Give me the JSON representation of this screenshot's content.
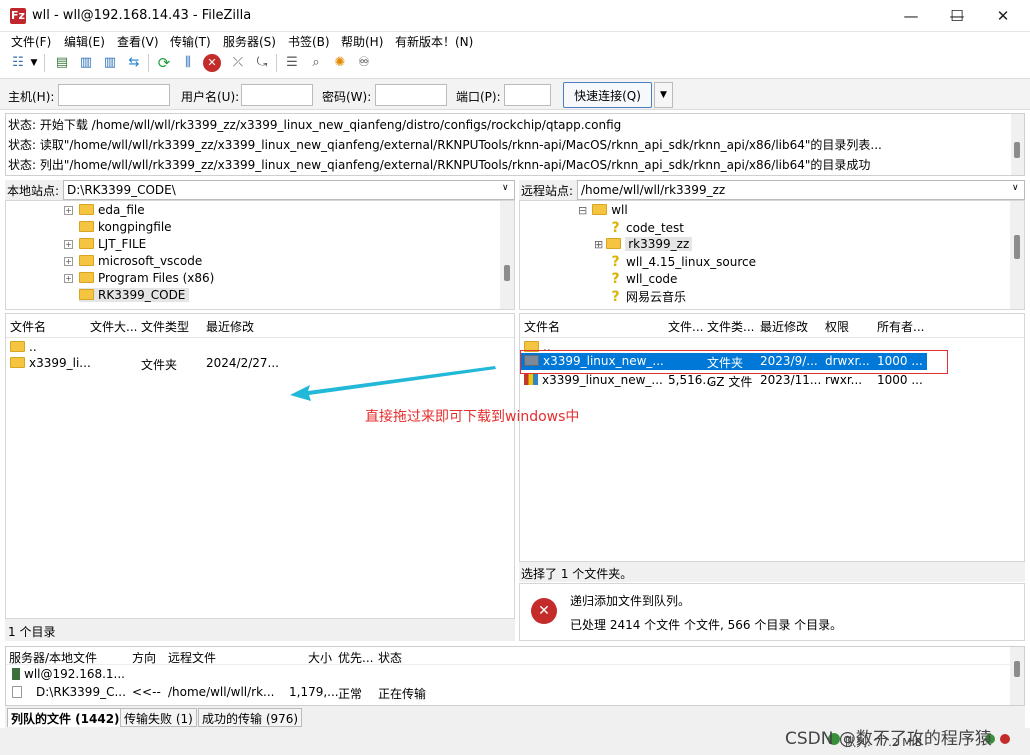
{
  "window": {
    "title": "wll - wll@192.168.14.43 - FileZilla",
    "app_icon_text": "Fz",
    "minimize": "—",
    "maximize": "☐",
    "close": "✕"
  },
  "menu": [
    "文件(F)",
    "编辑(E)",
    "查看(V)",
    "传输(T)",
    "服务器(S)",
    "书签(B)",
    "帮助(H)",
    "有新版本！(N)"
  ],
  "toolbar_icons": [
    "site-manager-icon",
    "dropdown-arrow-icon",
    "toggle-log-icon",
    "toggle-local-tree-icon",
    "toggle-remote-tree-icon",
    "toggle-queue-icon",
    "refresh-icon",
    "filter-icon",
    "cancel-icon",
    "disconnect-icon",
    "reconnect-icon",
    "directory-compare-icon",
    "search-icon",
    "sync-browse-icon",
    "find-files-icon"
  ],
  "quickconnect": {
    "host_label": "主机(H):",
    "user_label": "用户名(U):",
    "pass_label": "密码(W):",
    "port_label": "端口(P):",
    "button": "快速连接(Q)",
    "dropdown": "▼"
  },
  "log": [
    "状态: 开始下载 /home/wll/wll/rk3399_zz/x3399_linux_new_qianfeng/distro/configs/rockchip/qtapp.config",
    "状态: 读取\"/home/wll/wll/rk3399_zz/x3399_linux_new_qianfeng/external/RKNPUTools/rknn-api/MacOS/rknn_api_sdk/rknn_api/x86/lib64\"的目录列表...",
    "状态: 列出\"/home/wll/wll/rk3399_zz/x3399_linux_new_qianfeng/external/RKNPUTools/rknn-api/MacOS/rknn_api_sdk/rknn_api/x86/lib64\"的目录成功"
  ],
  "local": {
    "site_label": "本地站点:",
    "path": "D:\\RK3399_CODE\\",
    "tree": [
      {
        "name": "eda_file",
        "expandable": true
      },
      {
        "name": "kongpingfile",
        "expandable": false
      },
      {
        "name": "LJT_FILE",
        "expandable": true
      },
      {
        "name": "microsoft_vscode",
        "expandable": true
      },
      {
        "name": "Program Files (x86)",
        "expandable": true
      },
      {
        "name": "RK3399_CODE",
        "expandable": false
      }
    ],
    "columns": [
      "文件名",
      "文件大...",
      "文件类型",
      "最近修改"
    ],
    "rows": [
      {
        "name": "..",
        "size": "",
        "type": "",
        "modified": ""
      },
      {
        "name": "x3399_li...",
        "size": "",
        "type": "文件夹",
        "modified": "2024/2/27..."
      }
    ],
    "status": "1 个目录"
  },
  "remote": {
    "site_label": "远程站点:",
    "path": "/home/wll/wll/rk3399_zz",
    "tree": [
      {
        "name": "wll",
        "icon": "folder",
        "expander": "⊟"
      },
      {
        "name": "code_test",
        "icon": "question",
        "expander": ""
      },
      {
        "name": "rk3399_zz",
        "icon": "folder",
        "expander": "⊞"
      },
      {
        "name": "wll_4.15_linux_source",
        "icon": "question",
        "expander": ""
      },
      {
        "name": "wll_code",
        "icon": "question",
        "expander": ""
      },
      {
        "name": "网易云音乐",
        "icon": "question",
        "expander": ""
      }
    ],
    "columns": [
      "文件名",
      "文件...",
      "文件类...",
      "最近修改",
      "权限",
      "所有者..."
    ],
    "rows": [
      {
        "name": "..",
        "size": "",
        "type": "",
        "modified": "",
        "perm": "",
        "owner": ""
      },
      {
        "name": "x3399_linux_new_...",
        "size": "",
        "type": "文件夹",
        "modified": "2023/9/...",
        "perm": "drwxr...",
        "owner": "1000 ..."
      },
      {
        "name": "x3399_linux_new_...",
        "size": "5,516...",
        "type": "GZ 文件",
        "modified": "2023/11...",
        "perm": "rwxr...",
        "owner": "1000 ..."
      }
    ],
    "status": "选择了 1 个文件夹。"
  },
  "annotation": "直接拖过来即可下载到windows中",
  "notify": {
    "line1": "递归添加文件到队列。",
    "line2": "已处理 2414 个文件 个文件,  566 个目录 个目录。"
  },
  "queue": {
    "columns": [
      "服务器/本地文件",
      "方向",
      "远程文件",
      "大小",
      "优先...",
      "状态"
    ],
    "server": "wll@192.168.1...",
    "row": {
      "local": "D:\\RK3399_C...",
      "direction": "<<--",
      "remote": "/home/wll/wll/rk...",
      "size": "1,179,...",
      "priority": "正常",
      "status": "正在传输"
    }
  },
  "tabs": [
    "列队的文件 (1442)",
    "传输失败 (1)",
    "成功的传输 (976)"
  ],
  "bottom": {
    "queue_text": "队列: 77.2 MiB"
  },
  "watermark": "CSDN @数不了攻的程序猿",
  "colors": {
    "selection": "#0078d7",
    "annotation": "#e62e2e",
    "arrow": "#22b8d8"
  }
}
